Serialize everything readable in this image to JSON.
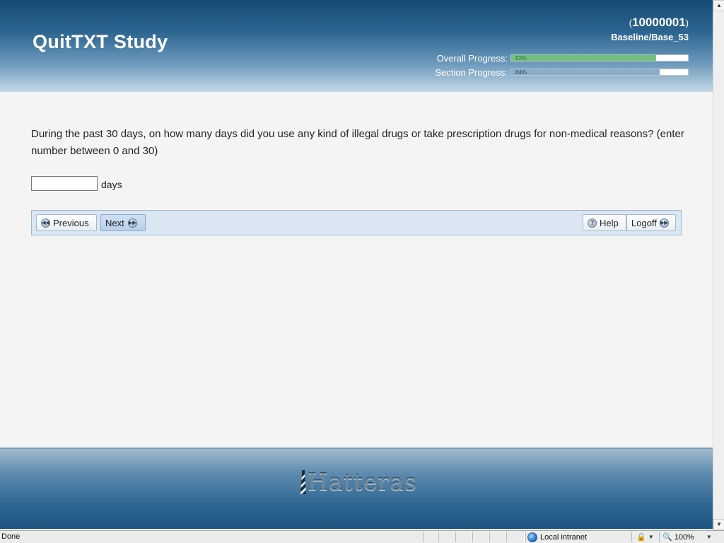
{
  "header": {
    "title": "QuitTXT Study",
    "participant_id": "10000001",
    "paren_open": "(",
    "paren_close": ")",
    "survey_path": "Baseline/Base_53",
    "overall_progress": {
      "label": "Overall Progress:",
      "value": 0.82,
      "text": "82%"
    },
    "section_progress": {
      "label": "Section Progress:",
      "value": 0.84,
      "text": "84%"
    }
  },
  "question": {
    "text": "During the past 30 days, on how many days did you use any kind of illegal drugs or take prescription drugs for non-medical reasons? (enter number between 0 and 30)",
    "input_value": "",
    "unit": "days"
  },
  "nav": {
    "previous_label": "Previous",
    "next_label": "Next",
    "help_label": "Help",
    "logoff_label": "Logoff"
  },
  "footer": {
    "brand": "Hatteras"
  },
  "statusbar": {
    "status_text": "Done",
    "zone": "Local intranet",
    "zoom": "100%"
  },
  "icons": {
    "previous": "rewind-circle-icon",
    "next": "fast-forward-circle-icon",
    "help": "help-circle-icon",
    "logoff": "fast-forward-circle-icon",
    "zone": "globe-icon",
    "protected_mode": "lock-icon"
  },
  "colors": {
    "header_dark": "#164a73",
    "overall_bar": "#74c27a",
    "section_bar": "#8aaec9",
    "nav_bg": "#dbe6f3",
    "page_bg": "#f4f4f4"
  }
}
